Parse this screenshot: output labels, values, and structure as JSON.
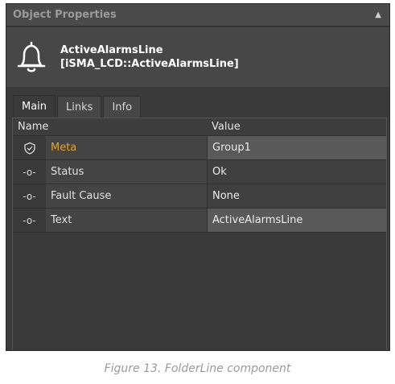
{
  "panel": {
    "title": "Object Properties",
    "pin_icon": "pin-icon"
  },
  "component": {
    "icon": "bell-icon",
    "name": "ActiveAlarmsLine",
    "type": "[iSMA_LCD::ActiveAlarmsLine]"
  },
  "tabs": [
    {
      "label": "Main",
      "active": true
    },
    {
      "label": "Links",
      "active": false
    },
    {
      "label": "Info",
      "active": false
    }
  ],
  "table": {
    "headers": {
      "name": "Name",
      "value": "Value"
    },
    "rows": [
      {
        "icon": "shield-icon",
        "name": "Meta",
        "value": "Group1",
        "highlight": true
      },
      {
        "icon": "slot-icon",
        "name": "Status",
        "value": "Ok"
      },
      {
        "icon": "slot-icon",
        "name": "Fault Cause",
        "value": "None"
      },
      {
        "icon": "slot-icon",
        "name": "Text",
        "value": "ActiveAlarmsLine"
      }
    ]
  },
  "caption": "Figure 13. FolderLine component",
  "colors": {
    "panel_bg": "#3a3a3a",
    "meta_accent": "#e6a22e"
  }
}
